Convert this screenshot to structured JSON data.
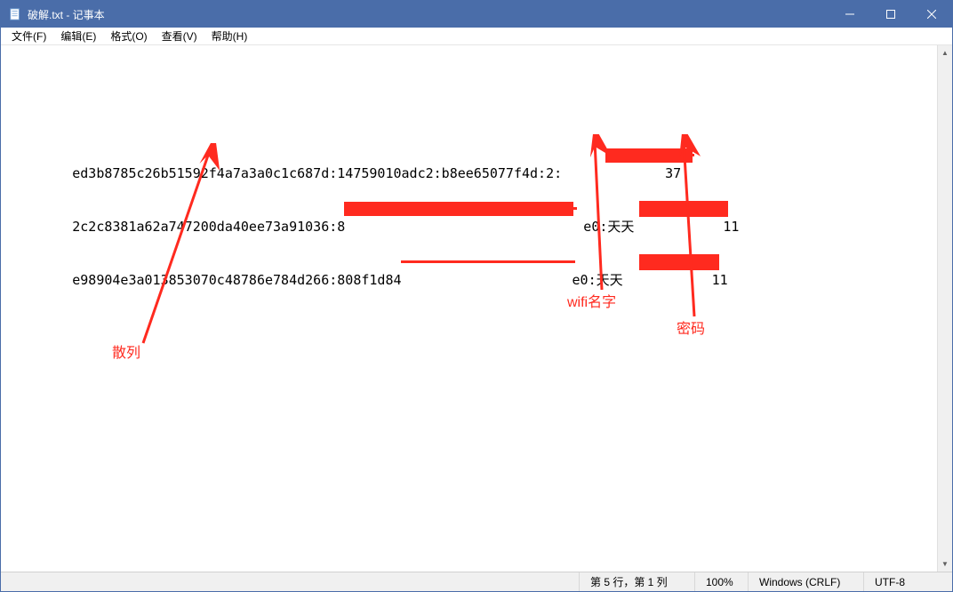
{
  "window": {
    "title": "破解.txt - 记事本"
  },
  "menu": {
    "file": "文件(F)",
    "edit": "编辑(E)",
    "format": "格式(O)",
    "view": "查看(V)",
    "help": "帮助(H)"
  },
  "content": {
    "line1_pre": "ed3b8785c26b51592f4a7a3a0c1c687d:14759010adc2:b8ee65077f4d:2:",
    "line1_post": "37",
    "line2_pre": "2c2c8381a62a747200da40ee73a91036:8",
    "line2_mid": "e0:天天",
    "line2_post": "11",
    "line3_pre": "e98904e3a013853070c48786e784d266:808f1d84",
    "line3_mid": "e0:天天",
    "line3_post": "11"
  },
  "annotations": {
    "hash": "散列",
    "wifi": "wifi名字",
    "password": "密码"
  },
  "status": {
    "position": "第 5 行，第 1 列",
    "zoom": "100%",
    "encoding_mode": "Windows (CRLF)",
    "encoding": "UTF-8"
  }
}
